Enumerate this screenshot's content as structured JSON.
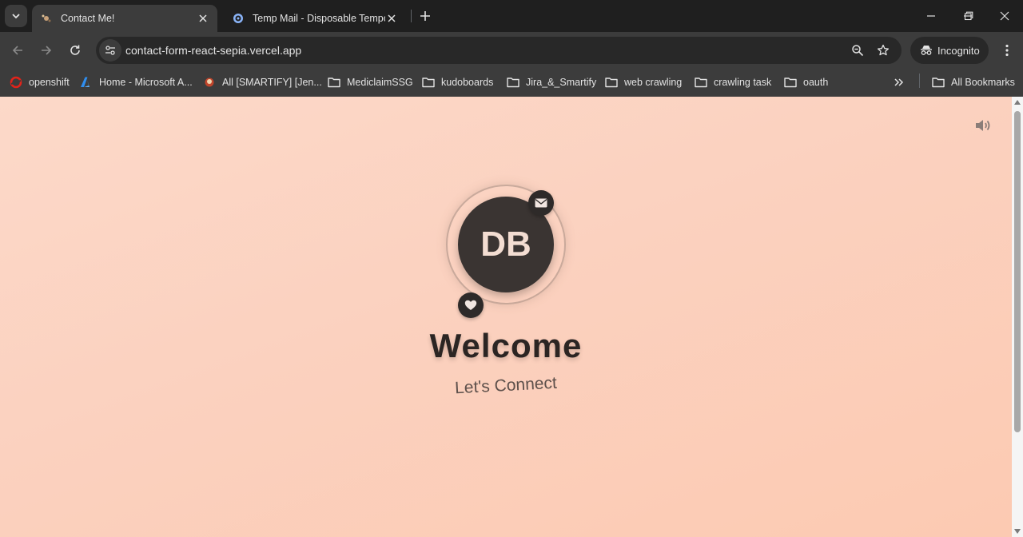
{
  "browser": {
    "tabs": [
      {
        "title": "Contact Me!",
        "active": true,
        "favicon": "page-favicon"
      },
      {
        "title": "Temp Mail - Disposable Tempor",
        "active": false,
        "favicon": "tempmail-favicon"
      }
    ],
    "address_bar": {
      "url": "contact-form-react-sepia.vercel.app"
    },
    "incognito_label": "Incognito",
    "bookmarks": [
      {
        "label": "openshift",
        "icon": "openshift-icon"
      },
      {
        "label": "Home - Microsoft A...",
        "icon": "azure-icon"
      },
      {
        "label": "All [SMARTIFY] [Jen...",
        "icon": "jenkins-icon"
      },
      {
        "label": "MediclaimSSG",
        "icon": "folder-icon"
      },
      {
        "label": "kudoboards",
        "icon": "folder-icon"
      },
      {
        "label": "Jira_&_Smartify",
        "icon": "folder-icon"
      },
      {
        "label": "web crawling",
        "icon": "folder-icon"
      },
      {
        "label": "crawling task",
        "icon": "folder-icon"
      },
      {
        "label": "oauth",
        "icon": "folder-icon"
      }
    ],
    "all_bookmarks_label": "All Bookmarks"
  },
  "page": {
    "avatar_initials": "DB",
    "heading": "Welcome",
    "subheading": "Let's Connect"
  },
  "colors": {
    "page_bg": "#fcd4c2",
    "avatar_bg": "#3a3432",
    "text_dark": "#2b2523",
    "browser_chrome": "#3c3c3c"
  }
}
